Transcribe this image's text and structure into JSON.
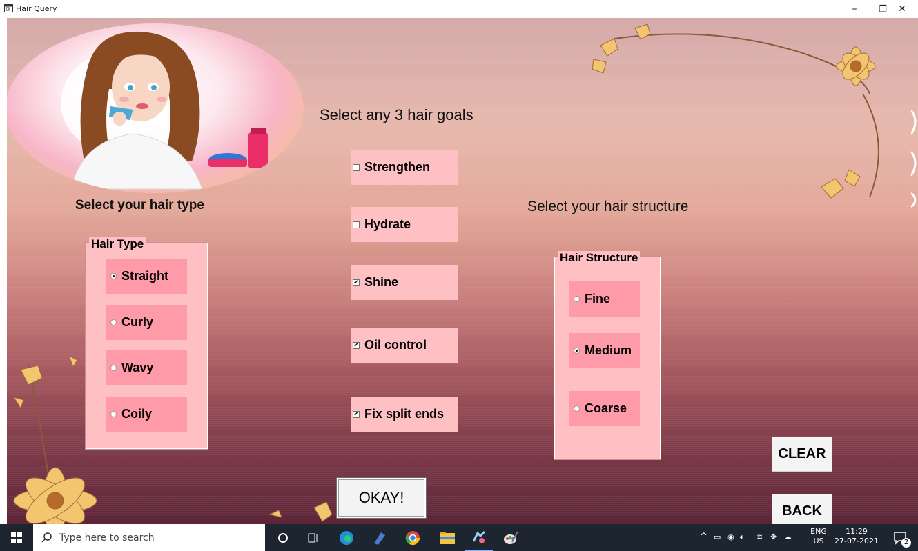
{
  "window": {
    "title": "Hair Query",
    "minimize": "–",
    "maximize": "❐",
    "close": "✕"
  },
  "headings": {
    "hair_goals": "Select any 3  hair goals",
    "hair_type": "Select your hair type",
    "hair_structure": "Select your hair structure"
  },
  "hair_type_group": {
    "legend": "Hair Type",
    "options": [
      {
        "label": "Straight",
        "selected": true
      },
      {
        "label": "Curly",
        "selected": false
      },
      {
        "label": "Wavy",
        "selected": false
      },
      {
        "label": "Coily",
        "selected": false
      }
    ]
  },
  "hair_goals": [
    {
      "label": "Strengthen",
      "checked": false
    },
    {
      "label": "Hydrate",
      "checked": false
    },
    {
      "label": "Shine",
      "checked": true
    },
    {
      "label": "Oil control",
      "checked": true
    },
    {
      "label": "Fix split ends",
      "checked": true
    }
  ],
  "hair_structure_group": {
    "legend": "Hair Structure",
    "options": [
      {
        "label": "Fine",
        "selected": false
      },
      {
        "label": "Medium",
        "selected": true
      },
      {
        "label": "Coarse",
        "selected": false
      }
    ]
  },
  "buttons": {
    "okay": "OKAY!",
    "clear": "CLEAR",
    "back": "BACK"
  },
  "taskbar": {
    "search_placeholder": "Type here to search",
    "tray": {
      "lang_top": "ENG",
      "lang_bottom": "US",
      "time": "11:29",
      "date": "27-07-2021",
      "notifications": "2"
    }
  },
  "colors": {
    "option_bg": "#ff9aa8",
    "group_bg": "#ffc0c4",
    "flower": "#f3c56e",
    "taskbar": "#1c2530"
  }
}
